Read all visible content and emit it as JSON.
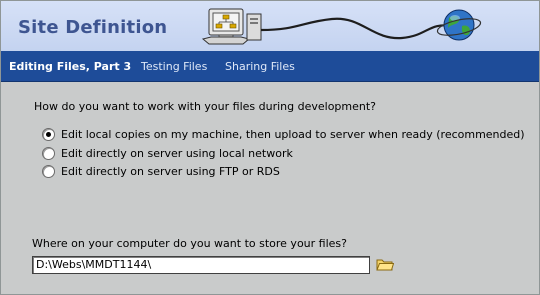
{
  "window": {
    "title": "Site Definition"
  },
  "tabs": [
    {
      "label": "Editing Files, Part 3",
      "active": true
    },
    {
      "label": "Testing Files",
      "active": false
    },
    {
      "label": "Sharing Files",
      "active": false
    }
  ],
  "question": "How do you want to work with your files during development?",
  "options": [
    {
      "label": "Edit local copies on my machine, then upload to server when ready (recommended)",
      "checked": true
    },
    {
      "label": "Edit directly on server using local network",
      "checked": false
    },
    {
      "label": "Edit directly on server using FTP or RDS",
      "checked": false
    }
  ],
  "storage": {
    "label": "Where on your computer do you want to store your files?",
    "path_value": "D:\\Webs\\MMDT1144\\"
  },
  "icons": {
    "header_art": "computer-network-globe-icon",
    "browse": "folder-icon"
  },
  "colors": {
    "header_bg": "#c4d3f0",
    "title": "#3e5591",
    "tab_bar": "#1e4c99",
    "body_bg": "#c9cbcb"
  }
}
